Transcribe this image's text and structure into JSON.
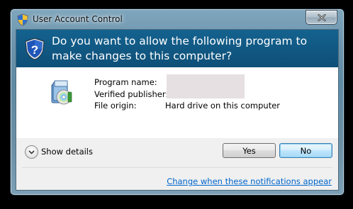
{
  "window": {
    "title": "User Account Control",
    "close_icon": "close-icon"
  },
  "banner": {
    "question": "Do you want to allow the following program to make changes to this computer?",
    "icon": "uac-shield-icon"
  },
  "details": {
    "app_icon": "program-installer-icon",
    "fields": [
      {
        "label": "Program name:",
        "value": ""
      },
      {
        "label": "Verified publisher:",
        "value": ""
      },
      {
        "label": "File origin:",
        "value": "Hard drive on this computer"
      }
    ],
    "redaction_color": "#e6e0e2"
  },
  "footer": {
    "show_details_label": "Show details",
    "yes_label": "Yes",
    "no_label": "No",
    "notifications_link": "Change when these notifications appear"
  },
  "colors": {
    "banner": "#14628f",
    "link": "#0066cc",
    "default_button_border": "#3c7fb1"
  }
}
